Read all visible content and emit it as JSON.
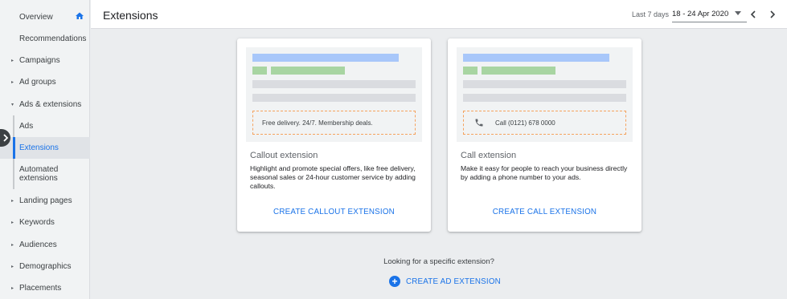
{
  "sidebar": {
    "items": [
      {
        "label": "Overview",
        "icon": "home-icon"
      },
      {
        "label": "Recommendations"
      },
      {
        "label": "Campaigns",
        "caret": "▸"
      },
      {
        "label": "Ad groups",
        "caret": "▸"
      },
      {
        "label": "Ads & extensions",
        "caret": "▾"
      },
      {
        "label": "Ads"
      },
      {
        "label": "Extensions",
        "active": true
      },
      {
        "label": "Automated",
        "label2": "extensions"
      },
      {
        "label": "Landing pages",
        "caret": "▸"
      },
      {
        "label": "Keywords",
        "caret": "▸"
      },
      {
        "label": "Audiences",
        "caret": "▸"
      },
      {
        "label": "Demographics",
        "caret": "▸"
      },
      {
        "label": "Placements",
        "caret": "▸"
      }
    ]
  },
  "header": {
    "title": "Extensions",
    "date_label": "Last 7 days",
    "date_range": "18 - 24 Apr 2020"
  },
  "cards": {
    "callout": {
      "preview_text": "Free delivery. 24/7. Membership deals.",
      "title": "Callout extension",
      "description": "Highlight and promote special offers, like free delivery, seasonal sales or 24-hour customer service by adding callouts.",
      "cta": "CREATE CALLOUT EXTENSION"
    },
    "call": {
      "preview_text": "Call (0121) 678 0000",
      "title": "Call extension",
      "description": "Make it easy for people to reach your business directly by adding a phone number to your ads.",
      "cta": "CREATE CALL EXTENSION"
    }
  },
  "footer": {
    "prompt": "Looking for a specific extension?",
    "cta": "CREATE AD EXTENSION"
  },
  "colors": {
    "accent": "#1a73e8",
    "preview_blue": "#a8c7fa",
    "preview_green": "#a8d5a2",
    "preview_gray": "#dadce0",
    "callout_border": "#f5a25d"
  }
}
